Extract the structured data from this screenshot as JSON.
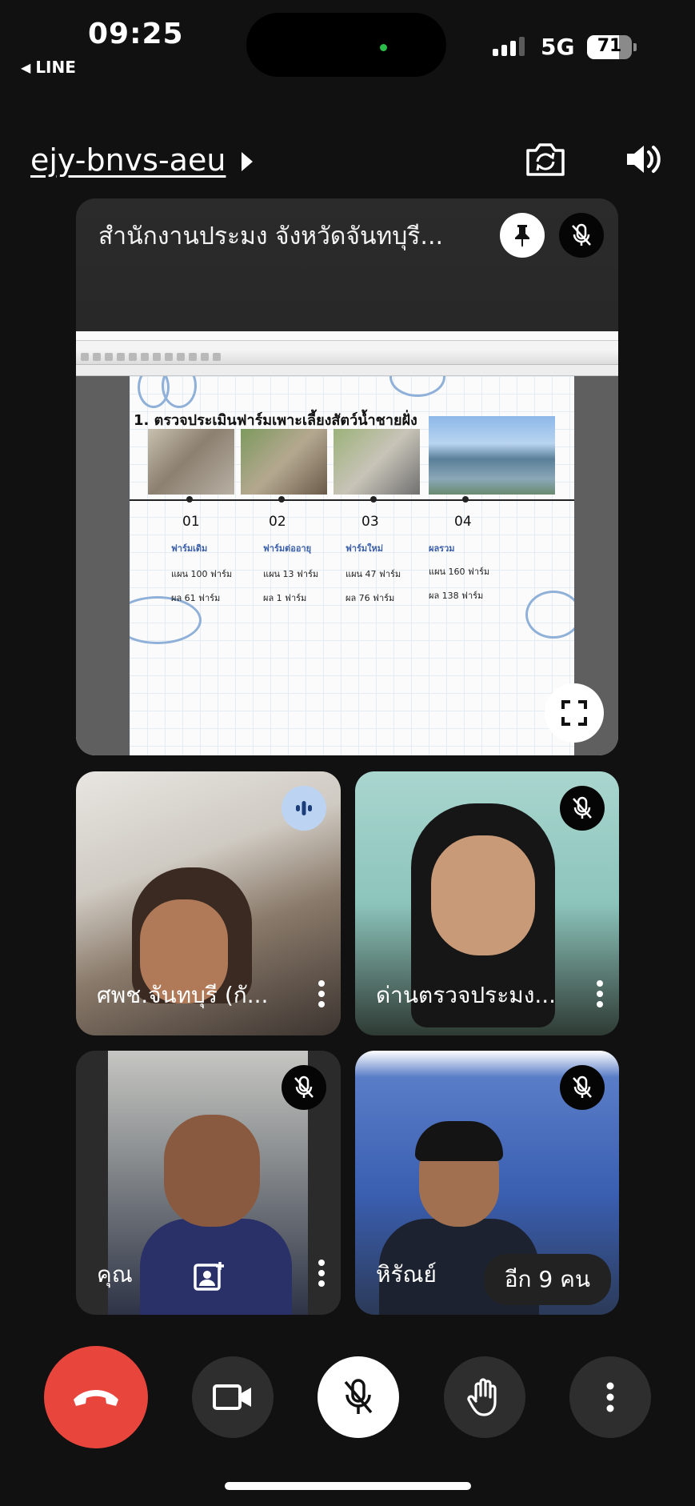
{
  "status_bar": {
    "time": "09:25",
    "back_app": "LINE",
    "network": "5G",
    "battery": "71",
    "battery_level": 0.71
  },
  "header": {
    "meeting_code": "ejy-bnvs-aeu"
  },
  "presentation": {
    "title": "สำนักงานประมง จังหวัดจันทบุรี...",
    "slide": {
      "heading": "1. ตรวจประเมินฟาร์มเพาะเลี้ยงสัตว์น้ำชายฝั่ง",
      "steps": [
        {
          "num": "01",
          "label": "ฟาร์มเดิม",
          "plan": "แผน 100 ฟาร์ม",
          "result": "ผล 61 ฟาร์ม"
        },
        {
          "num": "02",
          "label": "ฟาร์มต่ออายุ",
          "plan": "แผน 13 ฟาร์ม",
          "result": "ผล 1 ฟาร์ม"
        },
        {
          "num": "03",
          "label": "ฟาร์มใหม่",
          "plan": "แผน 47 ฟาร์ม",
          "result": "ผล 76 ฟาร์ม"
        },
        {
          "num": "04",
          "label": "ผลรวม",
          "plan": "แผน 160 ฟาร์ม",
          "result": "ผล 138 ฟาร์ม"
        }
      ]
    }
  },
  "participants": [
    {
      "name": "ศพช.จันทบุรี (กั...",
      "status": "speaking"
    },
    {
      "name": "ด่านตรวจประมง...",
      "status": "muted"
    },
    {
      "name": "คุณ",
      "status": "muted"
    },
    {
      "name": "หิรัณย์",
      "status": "muted"
    }
  ],
  "more_participants": "อีก 9 คน",
  "colors": {
    "end_call": "#e8453c",
    "control_bg": "#2e2e2e",
    "tile_bg": "#2b2b2b",
    "speaking_badge": "#bcd3f2"
  }
}
